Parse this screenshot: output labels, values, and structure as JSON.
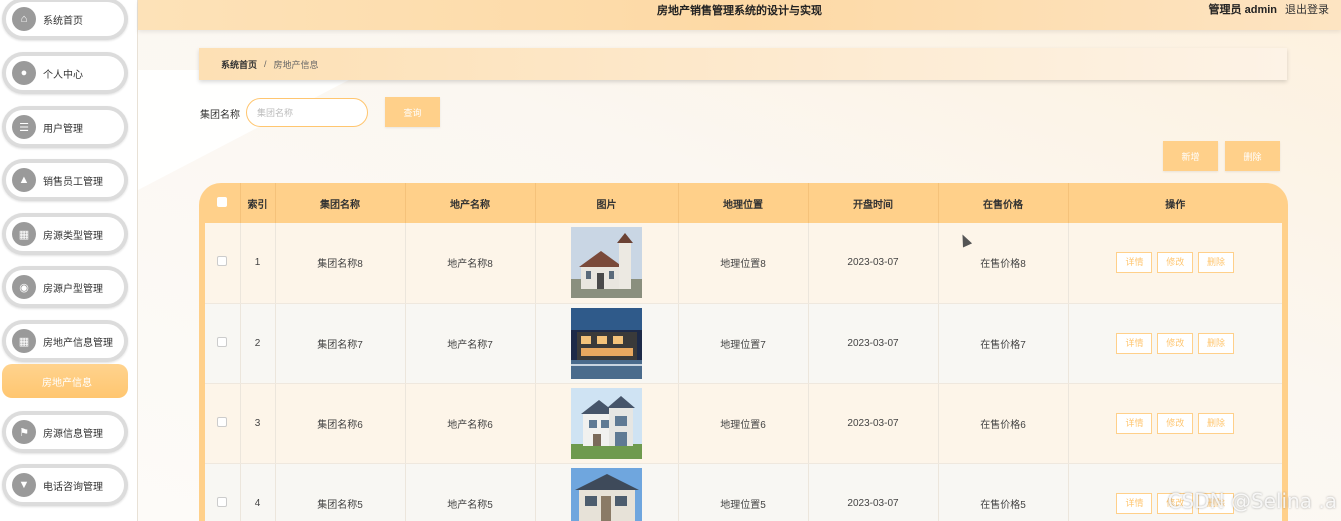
{
  "header": {
    "title": "房地产销售管理系统的设计与实现",
    "user": "管理员 admin",
    "logout": "退出登录"
  },
  "sidebar": {
    "items": [
      {
        "label": "系统首页",
        "icon": "home-icon"
      },
      {
        "label": "个人中心",
        "icon": "user-icon"
      },
      {
        "label": "用户管理",
        "icon": "list-icon"
      },
      {
        "label": "销售员工管理",
        "icon": "thumb-icon"
      },
      {
        "label": "房源类型管理",
        "icon": "grid-icon"
      },
      {
        "label": "房源户型管理",
        "icon": "location-icon"
      },
      {
        "label": "房地产信息管理",
        "icon": "grid-icon"
      },
      {
        "label": "房源信息管理",
        "icon": "flag-icon"
      },
      {
        "label": "电话咨询管理",
        "icon": "pin-icon"
      }
    ],
    "active_sub": "房地产信息"
  },
  "breadcrumb": {
    "home": "系统首页",
    "separator": "/",
    "current": "房地产信息"
  },
  "search": {
    "label": "集团名称",
    "placeholder": "集团名称",
    "query_button": "查询"
  },
  "actions": {
    "add": "新增",
    "delete": "删除"
  },
  "table": {
    "headers": [
      "",
      "索引",
      "集团名称",
      "地产名称",
      "图片",
      "地理位置",
      "开盘时间",
      "在售价格",
      "操作"
    ],
    "rows": [
      {
        "index": "1",
        "group": "集团名称8",
        "estate": "地产名称8",
        "location": "地理位置8",
        "date": "2023-03-07",
        "price": "在售价格8"
      },
      {
        "index": "2",
        "group": "集团名称7",
        "estate": "地产名称7",
        "location": "地理位置7",
        "date": "2023-03-07",
        "price": "在售价格7"
      },
      {
        "index": "3",
        "group": "集团名称6",
        "estate": "地产名称6",
        "location": "地理位置6",
        "date": "2023-03-07",
        "price": "在售价格6"
      },
      {
        "index": "4",
        "group": "集团名称5",
        "estate": "地产名称5",
        "location": "地理位置5",
        "date": "2023-03-07",
        "price": "在售价格5"
      }
    ],
    "row_actions": [
      "详情",
      "修改",
      "删除"
    ]
  },
  "watermark": "CSDN @Selina .a",
  "colors": {
    "accent": "#ffd08a",
    "accent_dark": "#ffc670",
    "header_bg": "#fdd9a5"
  }
}
